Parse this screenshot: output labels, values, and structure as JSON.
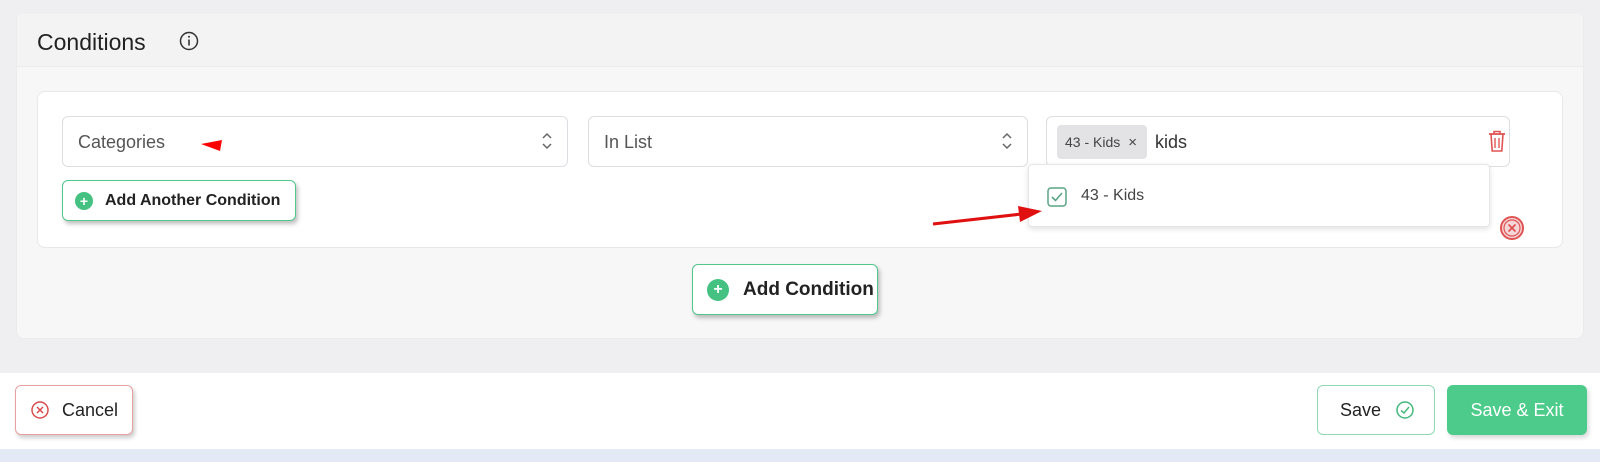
{
  "panel": {
    "title": "Conditions"
  },
  "condition": {
    "field": "Categories",
    "operator": "In List",
    "selected_chip": "43 - Kids",
    "chip_remove": "×",
    "search_value": "kids"
  },
  "dropdown": {
    "options": [
      {
        "label": "43 - Kids",
        "checked": true
      }
    ]
  },
  "buttons": {
    "add_another": "Add Another Condition",
    "add_condition": "Add Condition",
    "cancel": "Cancel",
    "save": "Save",
    "save_exit": "Save & Exit"
  },
  "colors": {
    "accent_green": "#4ccb8a",
    "danger_red": "#e05353",
    "annotation_red": "#ff0000"
  }
}
